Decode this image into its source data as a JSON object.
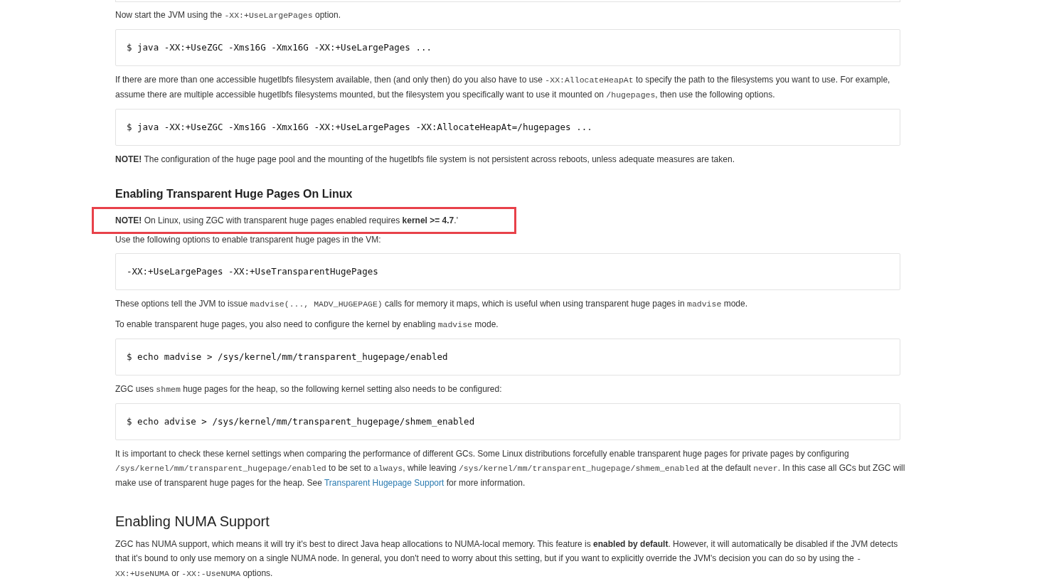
{
  "blocks": [
    {
      "kind": "paragraph",
      "segments": [
        {
          "kind": "text",
          "text": "Now start the JVM using the "
        },
        {
          "kind": "code",
          "text": "-XX:+UseLargePages"
        },
        {
          "kind": "text",
          "text": " option."
        }
      ]
    },
    {
      "kind": "code",
      "text": "$ java -XX:+UseZGC -Xms16G -Xmx16G -XX:+UseLargePages ..."
    },
    {
      "kind": "paragraph",
      "segments": [
        {
          "kind": "text",
          "text": "If there are more than one accessible hugetlbfs filesystem available, then (and only then) do you also have to use "
        },
        {
          "kind": "code",
          "text": "-XX:AllocateHeapAt"
        },
        {
          "kind": "text",
          "text": " to specify the path to the filesystems you want to use. For example, assume there are multiple accessible hugetlbfs filesystems mounted, but the filesystem you specifically want to use it mounted on "
        },
        {
          "kind": "code",
          "text": "/hugepages"
        },
        {
          "kind": "text",
          "text": ", then use the following options."
        }
      ]
    },
    {
      "kind": "code",
      "text": "$ java -XX:+UseZGC -Xms16G -Xmx16G -XX:+UseLargePages -XX:AllocateHeapAt=/hugepages ..."
    },
    {
      "kind": "paragraph",
      "segments": [
        {
          "kind": "bold",
          "text": "NOTE!"
        },
        {
          "kind": "text",
          "text": " The configuration of the huge page pool and the mounting of the hugetlbfs file system is not persistent across reboots, unless adequate measures are taken."
        }
      ]
    },
    {
      "kind": "subtitle",
      "text": "Enabling Transparent Huge Pages On Linux"
    },
    {
      "kind": "paragraph",
      "highlighted": true,
      "segments": [
        {
          "kind": "bold",
          "text": "NOTE!"
        },
        {
          "kind": "text",
          "text": " On Linux, using ZGC with transparent huge pages enabled requires "
        },
        {
          "kind": "bold",
          "text": "kernel >= 4.7"
        },
        {
          "kind": "text",
          "text": ".'"
        }
      ]
    },
    {
      "kind": "paragraph",
      "segments": [
        {
          "kind": "text",
          "text": "Use the following options to enable transparent huge pages in the VM:"
        }
      ]
    },
    {
      "kind": "code",
      "text": "-XX:+UseLargePages -XX:+UseTransparentHugePages"
    },
    {
      "kind": "paragraph",
      "segments": [
        {
          "kind": "text",
          "text": "These options tell the JVM to issue "
        },
        {
          "kind": "code",
          "text": "madvise(..., MADV_HUGEPAGE)"
        },
        {
          "kind": "text",
          "text": " calls for memory it maps, which is useful when using transparent huge pages in "
        },
        {
          "kind": "code",
          "text": "madvise"
        },
        {
          "kind": "text",
          "text": " mode."
        }
      ]
    },
    {
      "kind": "paragraph",
      "segments": [
        {
          "kind": "text",
          "text": "To enable transparent huge pages, you also need to configure the kernel by enabling "
        },
        {
          "kind": "code",
          "text": "madvise"
        },
        {
          "kind": "text",
          "text": " mode."
        }
      ]
    },
    {
      "kind": "code",
      "text": "$ echo madvise > /sys/kernel/mm/transparent_hugepage/enabled"
    },
    {
      "kind": "paragraph",
      "segments": [
        {
          "kind": "text",
          "text": "ZGC uses "
        },
        {
          "kind": "code",
          "text": "shmem"
        },
        {
          "kind": "text",
          "text": " huge pages for the heap, so the following kernel setting also needs to be configured:"
        }
      ]
    },
    {
      "kind": "code",
      "text": "$ echo advise > /sys/kernel/mm/transparent_hugepage/shmem_enabled"
    },
    {
      "kind": "paragraph",
      "segments": [
        {
          "kind": "text",
          "text": "It is important to check these kernel settings when comparing the performance of different GCs. Some Linux distributions forcefully enable transparent huge pages for private pages by configuring "
        },
        {
          "kind": "code",
          "text": "/sys/kernel/mm/transparent_hugepage/enabled"
        },
        {
          "kind": "text",
          "text": " to be set to "
        },
        {
          "kind": "code",
          "text": "always"
        },
        {
          "kind": "text",
          "text": ", while leaving "
        },
        {
          "kind": "code",
          "text": "/sys/kernel/mm/transparent_hugepage/shmem_enabled"
        },
        {
          "kind": "text",
          "text": " at the default "
        },
        {
          "kind": "code",
          "text": "never"
        },
        {
          "kind": "text",
          "text": ". In this case all GCs but ZGC will make use of transparent huge pages for the heap. See "
        },
        {
          "kind": "link",
          "text": "Transparent Hugepage Support"
        },
        {
          "kind": "text",
          "text": " for more information."
        }
      ]
    },
    {
      "kind": "title",
      "text": "Enabling NUMA Support"
    },
    {
      "kind": "paragraph",
      "segments": [
        {
          "kind": "text",
          "text": "ZGC has NUMA support, which means it will try it's best to direct Java heap allocations to NUMA-local memory. This feature is "
        },
        {
          "kind": "bold",
          "text": "enabled by default"
        },
        {
          "kind": "text",
          "text": ". However, it will automatically be disabled if the JVM detects that it's bound to only use memory on a single NUMA node. In general, you don't need to worry about this setting, but if you want to explicitly override the JVM's decision you can do so by using the "
        },
        {
          "kind": "code",
          "text": "-XX:+UseNUMA"
        },
        {
          "kind": "text",
          "text": " or "
        },
        {
          "kind": "code",
          "text": "-XX:-UseNUMA"
        },
        {
          "kind": "text",
          "text": " options."
        }
      ]
    }
  ]
}
